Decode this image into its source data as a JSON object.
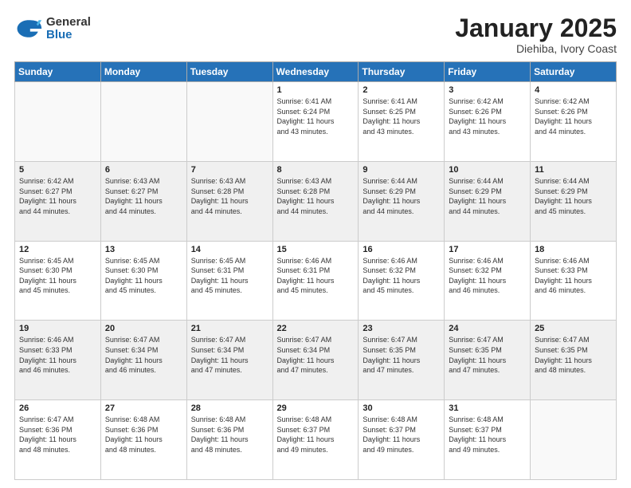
{
  "header": {
    "logo_general": "General",
    "logo_blue": "Blue",
    "month_title": "January 2025",
    "location": "Diehiba, Ivory Coast"
  },
  "days_of_week": [
    "Sunday",
    "Monday",
    "Tuesday",
    "Wednesday",
    "Thursday",
    "Friday",
    "Saturday"
  ],
  "weeks": [
    [
      {
        "num": "",
        "info": ""
      },
      {
        "num": "",
        "info": ""
      },
      {
        "num": "",
        "info": ""
      },
      {
        "num": "1",
        "info": "Sunrise: 6:41 AM\nSunset: 6:24 PM\nDaylight: 11 hours\nand 43 minutes."
      },
      {
        "num": "2",
        "info": "Sunrise: 6:41 AM\nSunset: 6:25 PM\nDaylight: 11 hours\nand 43 minutes."
      },
      {
        "num": "3",
        "info": "Sunrise: 6:42 AM\nSunset: 6:26 PM\nDaylight: 11 hours\nand 43 minutes."
      },
      {
        "num": "4",
        "info": "Sunrise: 6:42 AM\nSunset: 6:26 PM\nDaylight: 11 hours\nand 44 minutes."
      }
    ],
    [
      {
        "num": "5",
        "info": "Sunrise: 6:42 AM\nSunset: 6:27 PM\nDaylight: 11 hours\nand 44 minutes."
      },
      {
        "num": "6",
        "info": "Sunrise: 6:43 AM\nSunset: 6:27 PM\nDaylight: 11 hours\nand 44 minutes."
      },
      {
        "num": "7",
        "info": "Sunrise: 6:43 AM\nSunset: 6:28 PM\nDaylight: 11 hours\nand 44 minutes."
      },
      {
        "num": "8",
        "info": "Sunrise: 6:43 AM\nSunset: 6:28 PM\nDaylight: 11 hours\nand 44 minutes."
      },
      {
        "num": "9",
        "info": "Sunrise: 6:44 AM\nSunset: 6:29 PM\nDaylight: 11 hours\nand 44 minutes."
      },
      {
        "num": "10",
        "info": "Sunrise: 6:44 AM\nSunset: 6:29 PM\nDaylight: 11 hours\nand 44 minutes."
      },
      {
        "num": "11",
        "info": "Sunrise: 6:44 AM\nSunset: 6:29 PM\nDaylight: 11 hours\nand 45 minutes."
      }
    ],
    [
      {
        "num": "12",
        "info": "Sunrise: 6:45 AM\nSunset: 6:30 PM\nDaylight: 11 hours\nand 45 minutes."
      },
      {
        "num": "13",
        "info": "Sunrise: 6:45 AM\nSunset: 6:30 PM\nDaylight: 11 hours\nand 45 minutes."
      },
      {
        "num": "14",
        "info": "Sunrise: 6:45 AM\nSunset: 6:31 PM\nDaylight: 11 hours\nand 45 minutes."
      },
      {
        "num": "15",
        "info": "Sunrise: 6:46 AM\nSunset: 6:31 PM\nDaylight: 11 hours\nand 45 minutes."
      },
      {
        "num": "16",
        "info": "Sunrise: 6:46 AM\nSunset: 6:32 PM\nDaylight: 11 hours\nand 45 minutes."
      },
      {
        "num": "17",
        "info": "Sunrise: 6:46 AM\nSunset: 6:32 PM\nDaylight: 11 hours\nand 46 minutes."
      },
      {
        "num": "18",
        "info": "Sunrise: 6:46 AM\nSunset: 6:33 PM\nDaylight: 11 hours\nand 46 minutes."
      }
    ],
    [
      {
        "num": "19",
        "info": "Sunrise: 6:46 AM\nSunset: 6:33 PM\nDaylight: 11 hours\nand 46 minutes."
      },
      {
        "num": "20",
        "info": "Sunrise: 6:47 AM\nSunset: 6:34 PM\nDaylight: 11 hours\nand 46 minutes."
      },
      {
        "num": "21",
        "info": "Sunrise: 6:47 AM\nSunset: 6:34 PM\nDaylight: 11 hours\nand 47 minutes."
      },
      {
        "num": "22",
        "info": "Sunrise: 6:47 AM\nSunset: 6:34 PM\nDaylight: 11 hours\nand 47 minutes."
      },
      {
        "num": "23",
        "info": "Sunrise: 6:47 AM\nSunset: 6:35 PM\nDaylight: 11 hours\nand 47 minutes."
      },
      {
        "num": "24",
        "info": "Sunrise: 6:47 AM\nSunset: 6:35 PM\nDaylight: 11 hours\nand 47 minutes."
      },
      {
        "num": "25",
        "info": "Sunrise: 6:47 AM\nSunset: 6:35 PM\nDaylight: 11 hours\nand 48 minutes."
      }
    ],
    [
      {
        "num": "26",
        "info": "Sunrise: 6:47 AM\nSunset: 6:36 PM\nDaylight: 11 hours\nand 48 minutes."
      },
      {
        "num": "27",
        "info": "Sunrise: 6:48 AM\nSunset: 6:36 PM\nDaylight: 11 hours\nand 48 minutes."
      },
      {
        "num": "28",
        "info": "Sunrise: 6:48 AM\nSunset: 6:36 PM\nDaylight: 11 hours\nand 48 minutes."
      },
      {
        "num": "29",
        "info": "Sunrise: 6:48 AM\nSunset: 6:37 PM\nDaylight: 11 hours\nand 49 minutes."
      },
      {
        "num": "30",
        "info": "Sunrise: 6:48 AM\nSunset: 6:37 PM\nDaylight: 11 hours\nand 49 minutes."
      },
      {
        "num": "31",
        "info": "Sunrise: 6:48 AM\nSunset: 6:37 PM\nDaylight: 11 hours\nand 49 minutes."
      },
      {
        "num": "",
        "info": ""
      }
    ]
  ]
}
